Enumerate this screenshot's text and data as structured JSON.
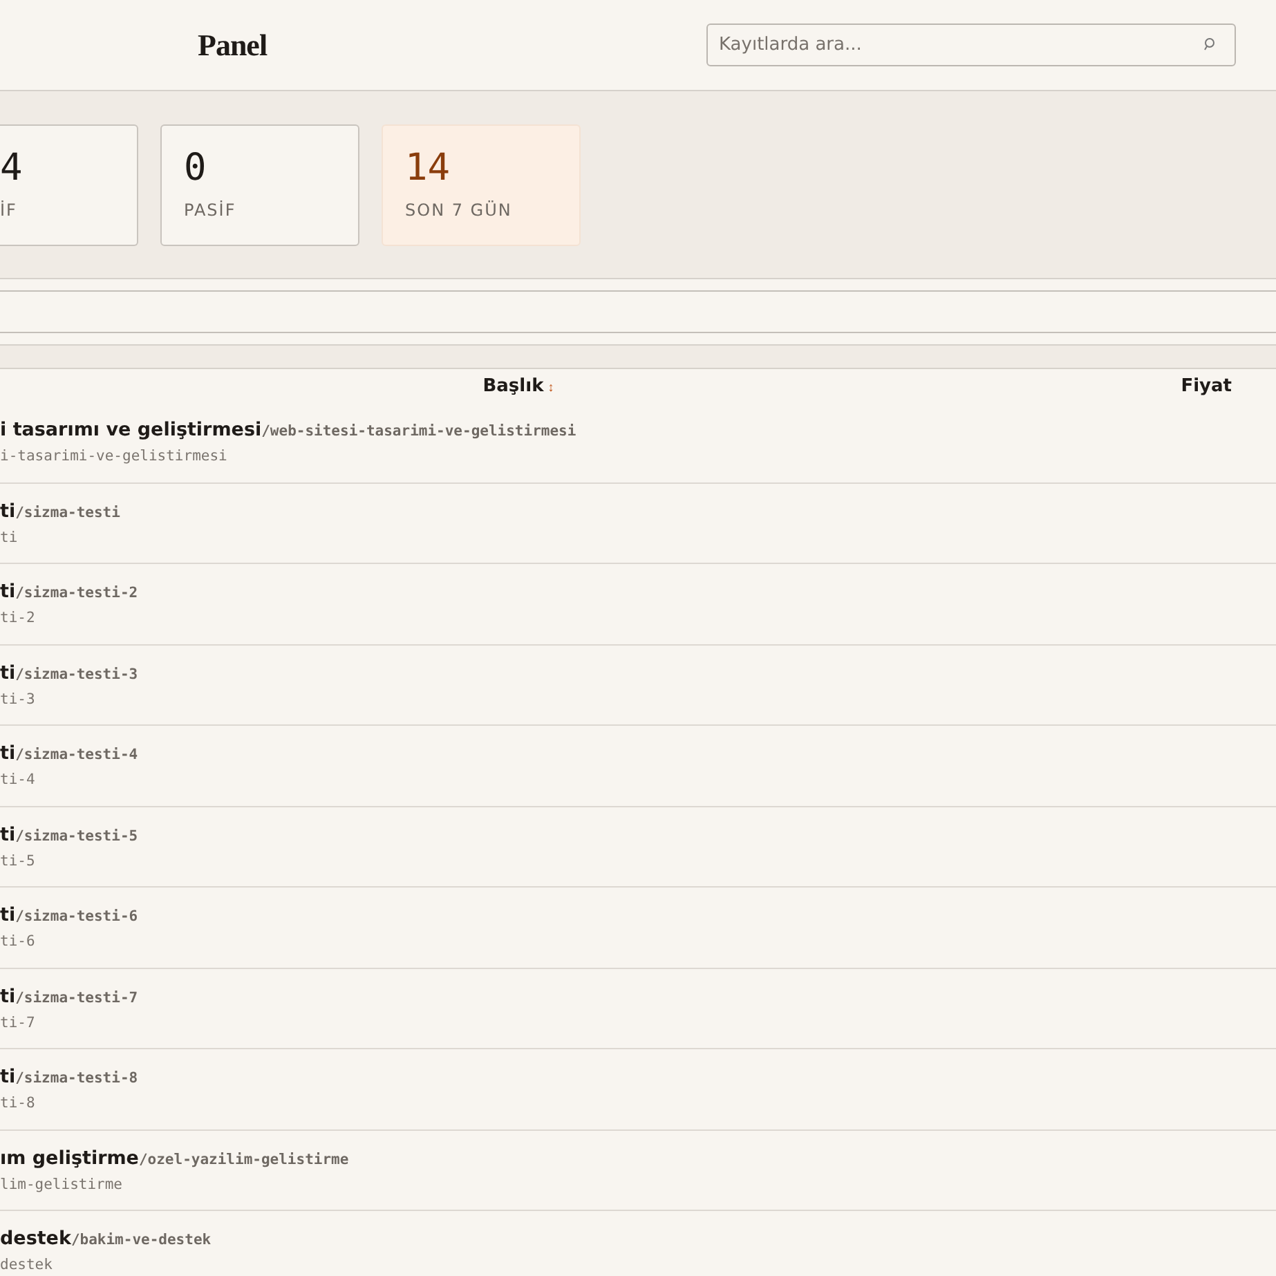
{
  "header": {
    "title": "Panel",
    "search": {
      "placeholder": "Kayıtlarda ara..."
    }
  },
  "stats": [
    {
      "value": "4",
      "label": "İF",
      "highlighted": false
    },
    {
      "value": "0",
      "label": "PASİF",
      "highlighted": false
    },
    {
      "value": "14",
      "label": "SON 7 GÜN",
      "highlighted": true
    }
  ],
  "table": {
    "columns": [
      {
        "label": "Başlık",
        "sort_indicator": "↕"
      },
      {
        "label": "Fiyat"
      }
    ],
    "rows": [
      {
        "title": "i tasarımı ve geliştirmesi",
        "slug": "/web-sitesi-tasarimi-ve-gelistirmesi",
        "subtitle": "i-tasarimi-ve-gelistirmesi"
      },
      {
        "title": "ti",
        "slug": "/sizma-testi",
        "subtitle": "ti"
      },
      {
        "title": "ti",
        "slug": "/sizma-testi-2",
        "subtitle": "ti-2"
      },
      {
        "title": "ti",
        "slug": "/sizma-testi-3",
        "subtitle": "ti-3"
      },
      {
        "title": "ti",
        "slug": "/sizma-testi-4",
        "subtitle": "ti-4"
      },
      {
        "title": "ti",
        "slug": "/sizma-testi-5",
        "subtitle": "ti-5"
      },
      {
        "title": "ti",
        "slug": "/sizma-testi-6",
        "subtitle": "ti-6"
      },
      {
        "title": "ti",
        "slug": "/sizma-testi-7",
        "subtitle": "ti-7"
      },
      {
        "title": "ti",
        "slug": "/sizma-testi-8",
        "subtitle": "ti-8"
      },
      {
        "title": "ım geliştirme",
        "slug": "/ozel-yazilim-gelistirme",
        "subtitle": "lim-gelistirme"
      },
      {
        "title": "destek",
        "slug": "/bakim-ve-destek",
        "subtitle": "destek"
      }
    ]
  }
}
